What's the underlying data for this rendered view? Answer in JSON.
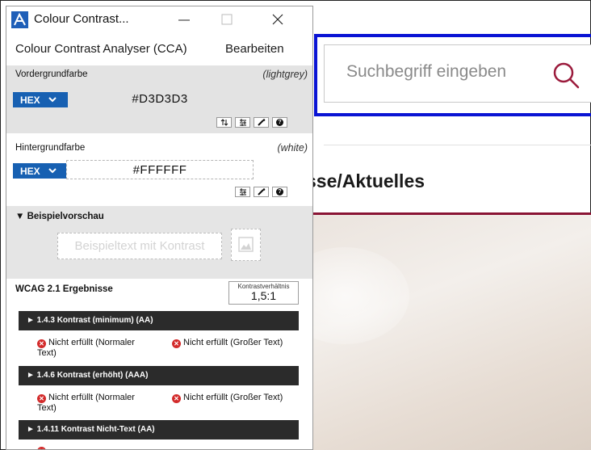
{
  "website": {
    "search_placeholder": "Suchbegriff eingeben",
    "news_heading": "sse/Aktuelles",
    "colors": {
      "focus_border": "#0a14d4",
      "accent_line": "#8a1434"
    }
  },
  "window": {
    "title": "Colour Contrast...",
    "controls": {
      "minimize": "—",
      "maximize": "☐",
      "close": "✕"
    },
    "menu": [
      "Colour Contrast Analyser (CCA)",
      "Bearbeiten"
    ]
  },
  "foreground": {
    "label": "Vordergrundfarbe",
    "hint": "(lightgrey)",
    "format": "HEX",
    "value": "#D3D3D3",
    "tools": [
      "swap-icon",
      "sliders-icon",
      "eyedropper-icon",
      "help-icon"
    ]
  },
  "background": {
    "label": "Hintergrundfarbe",
    "hint": "(white)",
    "format": "HEX",
    "value": "#FFFFFF",
    "tools": [
      "sliders-icon",
      "eyedropper-icon",
      "help-icon"
    ]
  },
  "preview": {
    "label": "▼ Beispielvorschau",
    "sample_text": "Beispieltext mit Kontrast"
  },
  "results": {
    "label": "WCAG 2.1 Ergebnisse",
    "ratio_label": "Kontrastverhältnis",
    "ratio": "1,5:1",
    "criteria": [
      {
        "title": "► 1.4.3 Kontrast (minimum) (AA)",
        "normal_line1": "Nicht erfüllt (Normaler",
        "normal_line2": "Text)",
        "large": "Nicht erfüllt (Großer Text)"
      },
      {
        "title": "► 1.4.6 Kontrast (erhöht) (AAA)",
        "normal_line1": "Nicht erfüllt (Normaler",
        "normal_line2": "Text)",
        "large": "Nicht erfüllt (Großer Text)"
      },
      {
        "title": "► 1.4.11 Kontrast Nicht-Text (AA)"
      }
    ]
  },
  "colors": {
    "brand_blue": "#1760b2",
    "fail_red": "#d32b2b"
  }
}
